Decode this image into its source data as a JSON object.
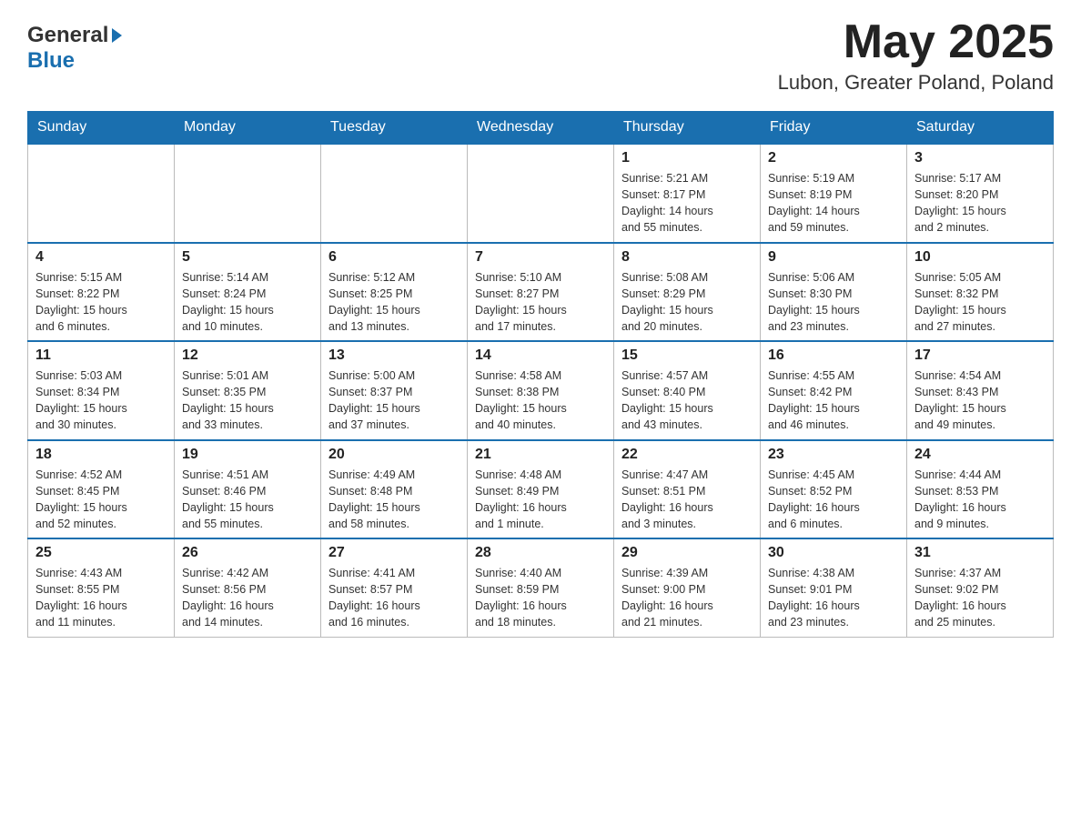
{
  "header": {
    "logo_general": "General",
    "logo_blue": "Blue",
    "month_year": "May 2025",
    "location": "Lubon, Greater Poland, Poland"
  },
  "days_of_week": [
    "Sunday",
    "Monday",
    "Tuesday",
    "Wednesday",
    "Thursday",
    "Friday",
    "Saturday"
  ],
  "weeks": [
    {
      "days": [
        {
          "number": "",
          "info": ""
        },
        {
          "number": "",
          "info": ""
        },
        {
          "number": "",
          "info": ""
        },
        {
          "number": "",
          "info": ""
        },
        {
          "number": "1",
          "info": "Sunrise: 5:21 AM\nSunset: 8:17 PM\nDaylight: 14 hours\nand 55 minutes."
        },
        {
          "number": "2",
          "info": "Sunrise: 5:19 AM\nSunset: 8:19 PM\nDaylight: 14 hours\nand 59 minutes."
        },
        {
          "number": "3",
          "info": "Sunrise: 5:17 AM\nSunset: 8:20 PM\nDaylight: 15 hours\nand 2 minutes."
        }
      ]
    },
    {
      "days": [
        {
          "number": "4",
          "info": "Sunrise: 5:15 AM\nSunset: 8:22 PM\nDaylight: 15 hours\nand 6 minutes."
        },
        {
          "number": "5",
          "info": "Sunrise: 5:14 AM\nSunset: 8:24 PM\nDaylight: 15 hours\nand 10 minutes."
        },
        {
          "number": "6",
          "info": "Sunrise: 5:12 AM\nSunset: 8:25 PM\nDaylight: 15 hours\nand 13 minutes."
        },
        {
          "number": "7",
          "info": "Sunrise: 5:10 AM\nSunset: 8:27 PM\nDaylight: 15 hours\nand 17 minutes."
        },
        {
          "number": "8",
          "info": "Sunrise: 5:08 AM\nSunset: 8:29 PM\nDaylight: 15 hours\nand 20 minutes."
        },
        {
          "number": "9",
          "info": "Sunrise: 5:06 AM\nSunset: 8:30 PM\nDaylight: 15 hours\nand 23 minutes."
        },
        {
          "number": "10",
          "info": "Sunrise: 5:05 AM\nSunset: 8:32 PM\nDaylight: 15 hours\nand 27 minutes."
        }
      ]
    },
    {
      "days": [
        {
          "number": "11",
          "info": "Sunrise: 5:03 AM\nSunset: 8:34 PM\nDaylight: 15 hours\nand 30 minutes."
        },
        {
          "number": "12",
          "info": "Sunrise: 5:01 AM\nSunset: 8:35 PM\nDaylight: 15 hours\nand 33 minutes."
        },
        {
          "number": "13",
          "info": "Sunrise: 5:00 AM\nSunset: 8:37 PM\nDaylight: 15 hours\nand 37 minutes."
        },
        {
          "number": "14",
          "info": "Sunrise: 4:58 AM\nSunset: 8:38 PM\nDaylight: 15 hours\nand 40 minutes."
        },
        {
          "number": "15",
          "info": "Sunrise: 4:57 AM\nSunset: 8:40 PM\nDaylight: 15 hours\nand 43 minutes."
        },
        {
          "number": "16",
          "info": "Sunrise: 4:55 AM\nSunset: 8:42 PM\nDaylight: 15 hours\nand 46 minutes."
        },
        {
          "number": "17",
          "info": "Sunrise: 4:54 AM\nSunset: 8:43 PM\nDaylight: 15 hours\nand 49 minutes."
        }
      ]
    },
    {
      "days": [
        {
          "number": "18",
          "info": "Sunrise: 4:52 AM\nSunset: 8:45 PM\nDaylight: 15 hours\nand 52 minutes."
        },
        {
          "number": "19",
          "info": "Sunrise: 4:51 AM\nSunset: 8:46 PM\nDaylight: 15 hours\nand 55 minutes."
        },
        {
          "number": "20",
          "info": "Sunrise: 4:49 AM\nSunset: 8:48 PM\nDaylight: 15 hours\nand 58 minutes."
        },
        {
          "number": "21",
          "info": "Sunrise: 4:48 AM\nSunset: 8:49 PM\nDaylight: 16 hours\nand 1 minute."
        },
        {
          "number": "22",
          "info": "Sunrise: 4:47 AM\nSunset: 8:51 PM\nDaylight: 16 hours\nand 3 minutes."
        },
        {
          "number": "23",
          "info": "Sunrise: 4:45 AM\nSunset: 8:52 PM\nDaylight: 16 hours\nand 6 minutes."
        },
        {
          "number": "24",
          "info": "Sunrise: 4:44 AM\nSunset: 8:53 PM\nDaylight: 16 hours\nand 9 minutes."
        }
      ]
    },
    {
      "days": [
        {
          "number": "25",
          "info": "Sunrise: 4:43 AM\nSunset: 8:55 PM\nDaylight: 16 hours\nand 11 minutes."
        },
        {
          "number": "26",
          "info": "Sunrise: 4:42 AM\nSunset: 8:56 PM\nDaylight: 16 hours\nand 14 minutes."
        },
        {
          "number": "27",
          "info": "Sunrise: 4:41 AM\nSunset: 8:57 PM\nDaylight: 16 hours\nand 16 minutes."
        },
        {
          "number": "28",
          "info": "Sunrise: 4:40 AM\nSunset: 8:59 PM\nDaylight: 16 hours\nand 18 minutes."
        },
        {
          "number": "29",
          "info": "Sunrise: 4:39 AM\nSunset: 9:00 PM\nDaylight: 16 hours\nand 21 minutes."
        },
        {
          "number": "30",
          "info": "Sunrise: 4:38 AM\nSunset: 9:01 PM\nDaylight: 16 hours\nand 23 minutes."
        },
        {
          "number": "31",
          "info": "Sunrise: 4:37 AM\nSunset: 9:02 PM\nDaylight: 16 hours\nand 25 minutes."
        }
      ]
    }
  ]
}
